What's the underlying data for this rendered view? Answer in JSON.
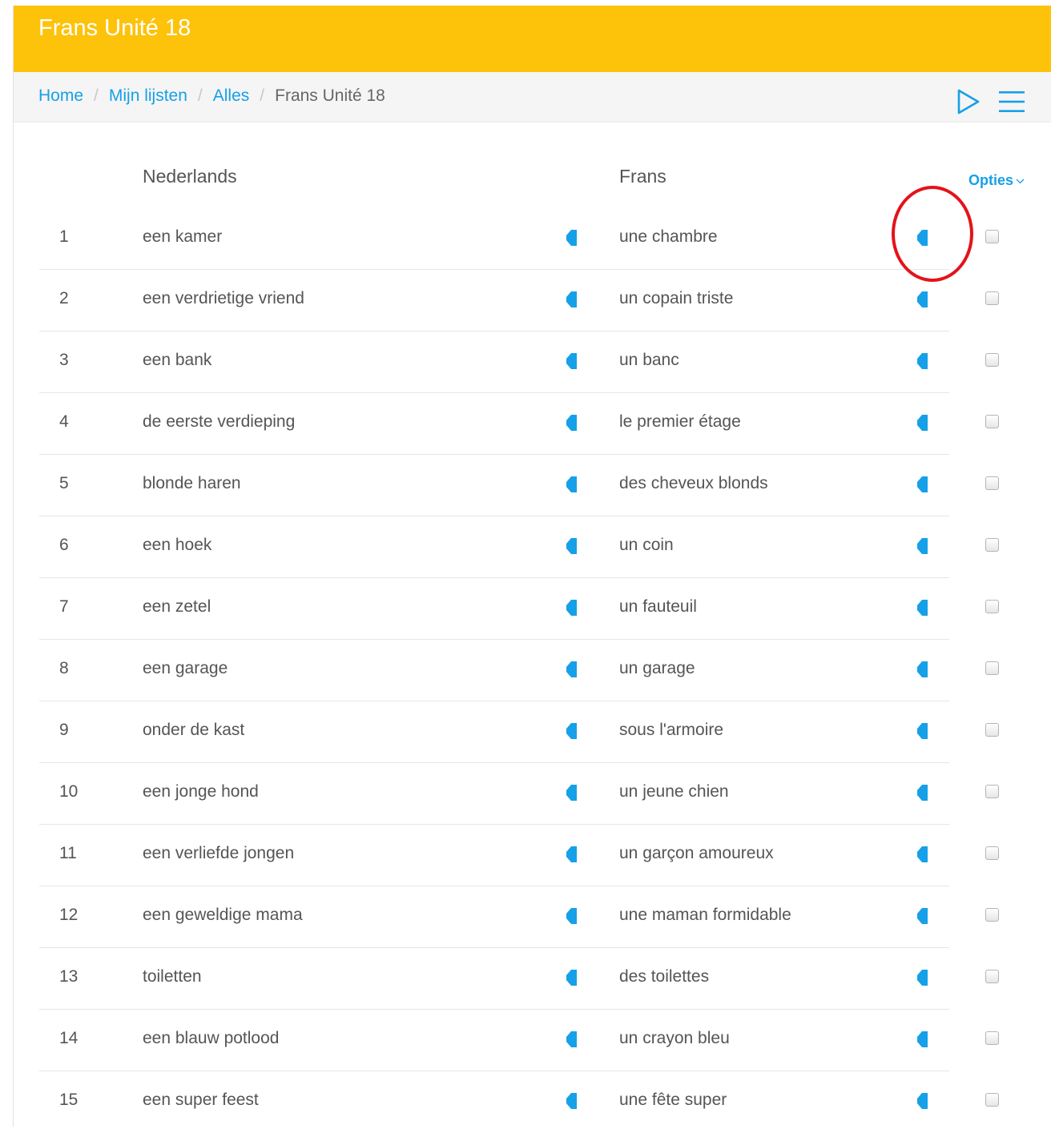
{
  "header": {
    "title": "Frans Unité 18",
    "background": "#fdc20a"
  },
  "breadcrumb": {
    "items": [
      {
        "label": "Home",
        "link": true
      },
      {
        "label": "Mijn lijsten",
        "link": true
      },
      {
        "label": "Alles",
        "link": true
      },
      {
        "label": "Frans Unité 18",
        "link": false
      }
    ],
    "separator": "/"
  },
  "toolbar": {
    "play_icon": "play-outline-icon",
    "menu_icon": "hamburger-menu-icon"
  },
  "table": {
    "columns": {
      "source": "Nederlands",
      "target": "Frans"
    },
    "options_label": "Opties",
    "rows": [
      {
        "number": "1",
        "source": "een kamer",
        "target": "une chambre"
      },
      {
        "number": "2",
        "source": "een verdrietige vriend",
        "target": "un copain triste"
      },
      {
        "number": "3",
        "source": "een bank",
        "target": "un banc"
      },
      {
        "number": "4",
        "source": "de eerste verdieping",
        "target": "le premier étage"
      },
      {
        "number": "5",
        "source": "blonde haren",
        "target": "des cheveux blonds"
      },
      {
        "number": "6",
        "source": "een hoek",
        "target": "un coin"
      },
      {
        "number": "7",
        "source": "een zetel",
        "target": "un fauteuil"
      },
      {
        "number": "8",
        "source": "een garage",
        "target": "un garage"
      },
      {
        "number": "9",
        "source": "onder de kast",
        "target": "sous l'armoire"
      },
      {
        "number": "10",
        "source": "een jonge hond",
        "target": "un jeune chien"
      },
      {
        "number": "11",
        "source": "een verliefde jongen",
        "target": "un garçon amoureux"
      },
      {
        "number": "12",
        "source": "een geweldige mama",
        "target": "une maman formidable"
      },
      {
        "number": "13",
        "source": "toiletten",
        "target": "des toilettes"
      },
      {
        "number": "14",
        "source": "een blauw potlood",
        "target": "un crayon bleu"
      },
      {
        "number": "15",
        "source": "een super feest",
        "target": "une fête super"
      }
    ]
  },
  "colors": {
    "accent": "#16a0e8",
    "text": "#555555",
    "annotation": "#e4131a"
  }
}
